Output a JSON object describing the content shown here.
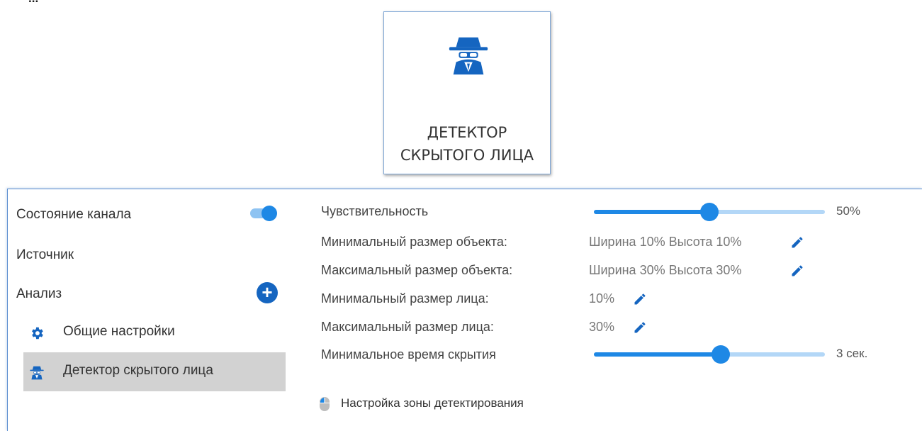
{
  "header": {
    "cut_text": "... ",
    "tile_label_line1": "ДЕТЕКТОР",
    "tile_label_line2": "СКРЫТОГО ЛИЦА",
    "tile_icon": "spy-icon"
  },
  "sidebar": {
    "channel_state_label": "Состояние канала",
    "channel_state_on": true,
    "source_label": "Источник",
    "analysis_label": "Анализ",
    "add_icon": "plus-icon",
    "items": [
      {
        "label": "Общие настройки",
        "icon": "gear-icon",
        "selected": false
      },
      {
        "label": "Детектор скрытого лица",
        "icon": "spy-icon",
        "selected": true
      }
    ]
  },
  "settings": {
    "sensitivity": {
      "label": "Чувствительность",
      "value_text": "50%",
      "value": 0.5
    },
    "min_object_size": {
      "label": "Минимальный размер объекта:",
      "value": "Ширина 10% Высота 10%"
    },
    "max_object_size": {
      "label": "Максимальный размер объекта:",
      "value": "Ширина 30% Высота 30%"
    },
    "min_face_size": {
      "label": "Минимальный размер лица:",
      "value": "10%"
    },
    "max_face_size": {
      "label": "Максимальный размер лица:",
      "value": "30%"
    },
    "min_hide_time": {
      "label": "Минимальное время скрытия",
      "value_text": "3 сек.",
      "value": 0.55
    },
    "zone_link": {
      "label": "Настройка зоны детектирования",
      "icon": "mouse-icon"
    }
  },
  "colors": {
    "accent": "#1e88e5",
    "accent_dark": "#1565c0",
    "rail": "#b3d7f7",
    "selected_bg": "#d2d2d2"
  }
}
